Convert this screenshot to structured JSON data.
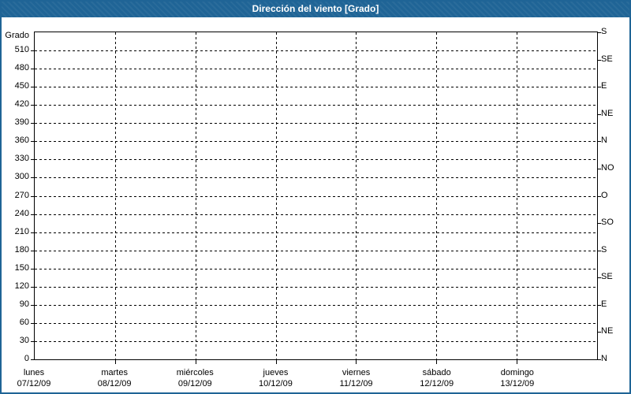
{
  "title": "Dirección del viento [Grado]",
  "colors": {
    "title_bar": "#1f6496",
    "frame_border": "#1f6496",
    "title_text": "#ffffff",
    "grid": "#000000",
    "axis_text": "#000000",
    "background": "#ffffff"
  },
  "chart_data": {
    "type": "line",
    "title": "Dirección del viento [Grado]",
    "ylabel": "Grado",
    "ylim": [
      0,
      540
    ],
    "y_tick_step": 30,
    "y_ticks": [
      0,
      30,
      60,
      90,
      120,
      150,
      180,
      210,
      240,
      270,
      300,
      330,
      360,
      390,
      420,
      450,
      480,
      510
    ],
    "right_axis": [
      {
        "deg": 0,
        "label": "N"
      },
      {
        "deg": 45,
        "label": "NE"
      },
      {
        "deg": 90,
        "label": "E"
      },
      {
        "deg": 135,
        "label": "SE"
      },
      {
        "deg": 180,
        "label": "S"
      },
      {
        "deg": 225,
        "label": "SO"
      },
      {
        "deg": 270,
        "label": "O"
      },
      {
        "deg": 315,
        "label": "NO"
      },
      {
        "deg": 360,
        "label": "N"
      },
      {
        "deg": 405,
        "label": "NE"
      },
      {
        "deg": 450,
        "label": "E"
      },
      {
        "deg": 495,
        "label": "SE"
      },
      {
        "deg": 540,
        "label": "S"
      }
    ],
    "x_categories": [
      {
        "name": "lunes",
        "date": "07/12/09"
      },
      {
        "name": "martes",
        "date": "08/12/09"
      },
      {
        "name": "miércoles",
        "date": "09/12/09"
      },
      {
        "name": "jueves",
        "date": "10/12/09"
      },
      {
        "name": "viernes",
        "date": "11/12/09"
      },
      {
        "name": "sábado",
        "date": "12/12/09"
      },
      {
        "name": "domingo",
        "date": "13/12/09"
      }
    ],
    "grid": "dashed",
    "legend": "none",
    "series": []
  }
}
